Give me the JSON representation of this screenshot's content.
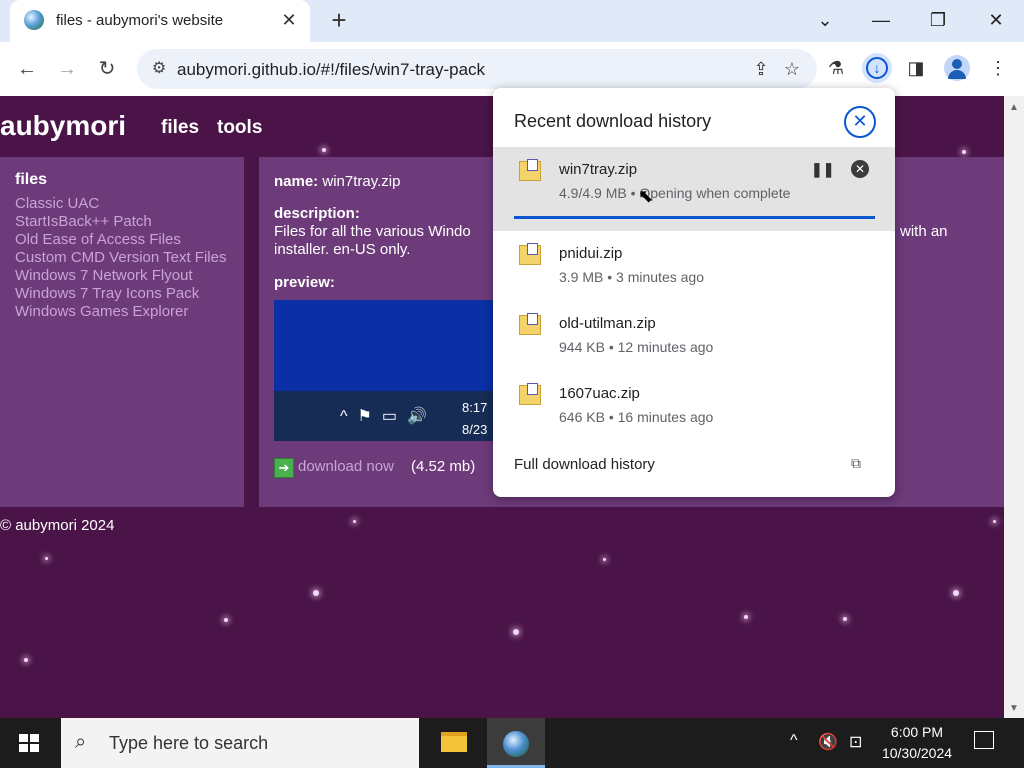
{
  "browser": {
    "tab_title": "files - aubymori's website",
    "url": "aubymori.github.io/#!/files/win7-tray-pack"
  },
  "site": {
    "name": "aubymori",
    "nav": [
      "files",
      "tools"
    ],
    "sidebar": {
      "heading": "files",
      "links": [
        "Classic UAC",
        "StartIsBack++ Patch",
        "Old Ease of Access Files",
        "Custom CMD Version Text Files",
        "Windows 7 Network Flyout",
        "Windows 7 Tray Icons Pack",
        "Windows Games Explorer"
      ]
    },
    "file": {
      "name_label": "name:",
      "name": "win7tray.zip",
      "description_label": "description:",
      "description_visible": "Files for all the various Windo",
      "description_tail": "with an",
      "description_line2": "installer. en-US only.",
      "preview_label": "preview:",
      "preview_time": "8:17",
      "preview_date": "8/23",
      "download_label": "download now",
      "download_size": "(4.52 mb)"
    },
    "footer": "© aubymori 2024"
  },
  "downloads_popup": {
    "title": "Recent download history",
    "items": [
      {
        "name": "win7tray.zip",
        "meta": "4.9/4.9 MB • Opening when complete",
        "progress": 1.0,
        "active": true
      },
      {
        "name": "pnidui.zip",
        "meta": "3.9 MB • 3 minutes ago"
      },
      {
        "name": "old-utilman.zip",
        "meta": "944 KB • 12 minutes ago"
      },
      {
        "name": "1607uac.zip",
        "meta": "646 KB • 16 minutes ago"
      }
    ],
    "full_history": "Full download history"
  },
  "taskbar": {
    "search_placeholder": "Type here to search",
    "time": "6:00 PM",
    "date": "10/30/2024"
  }
}
